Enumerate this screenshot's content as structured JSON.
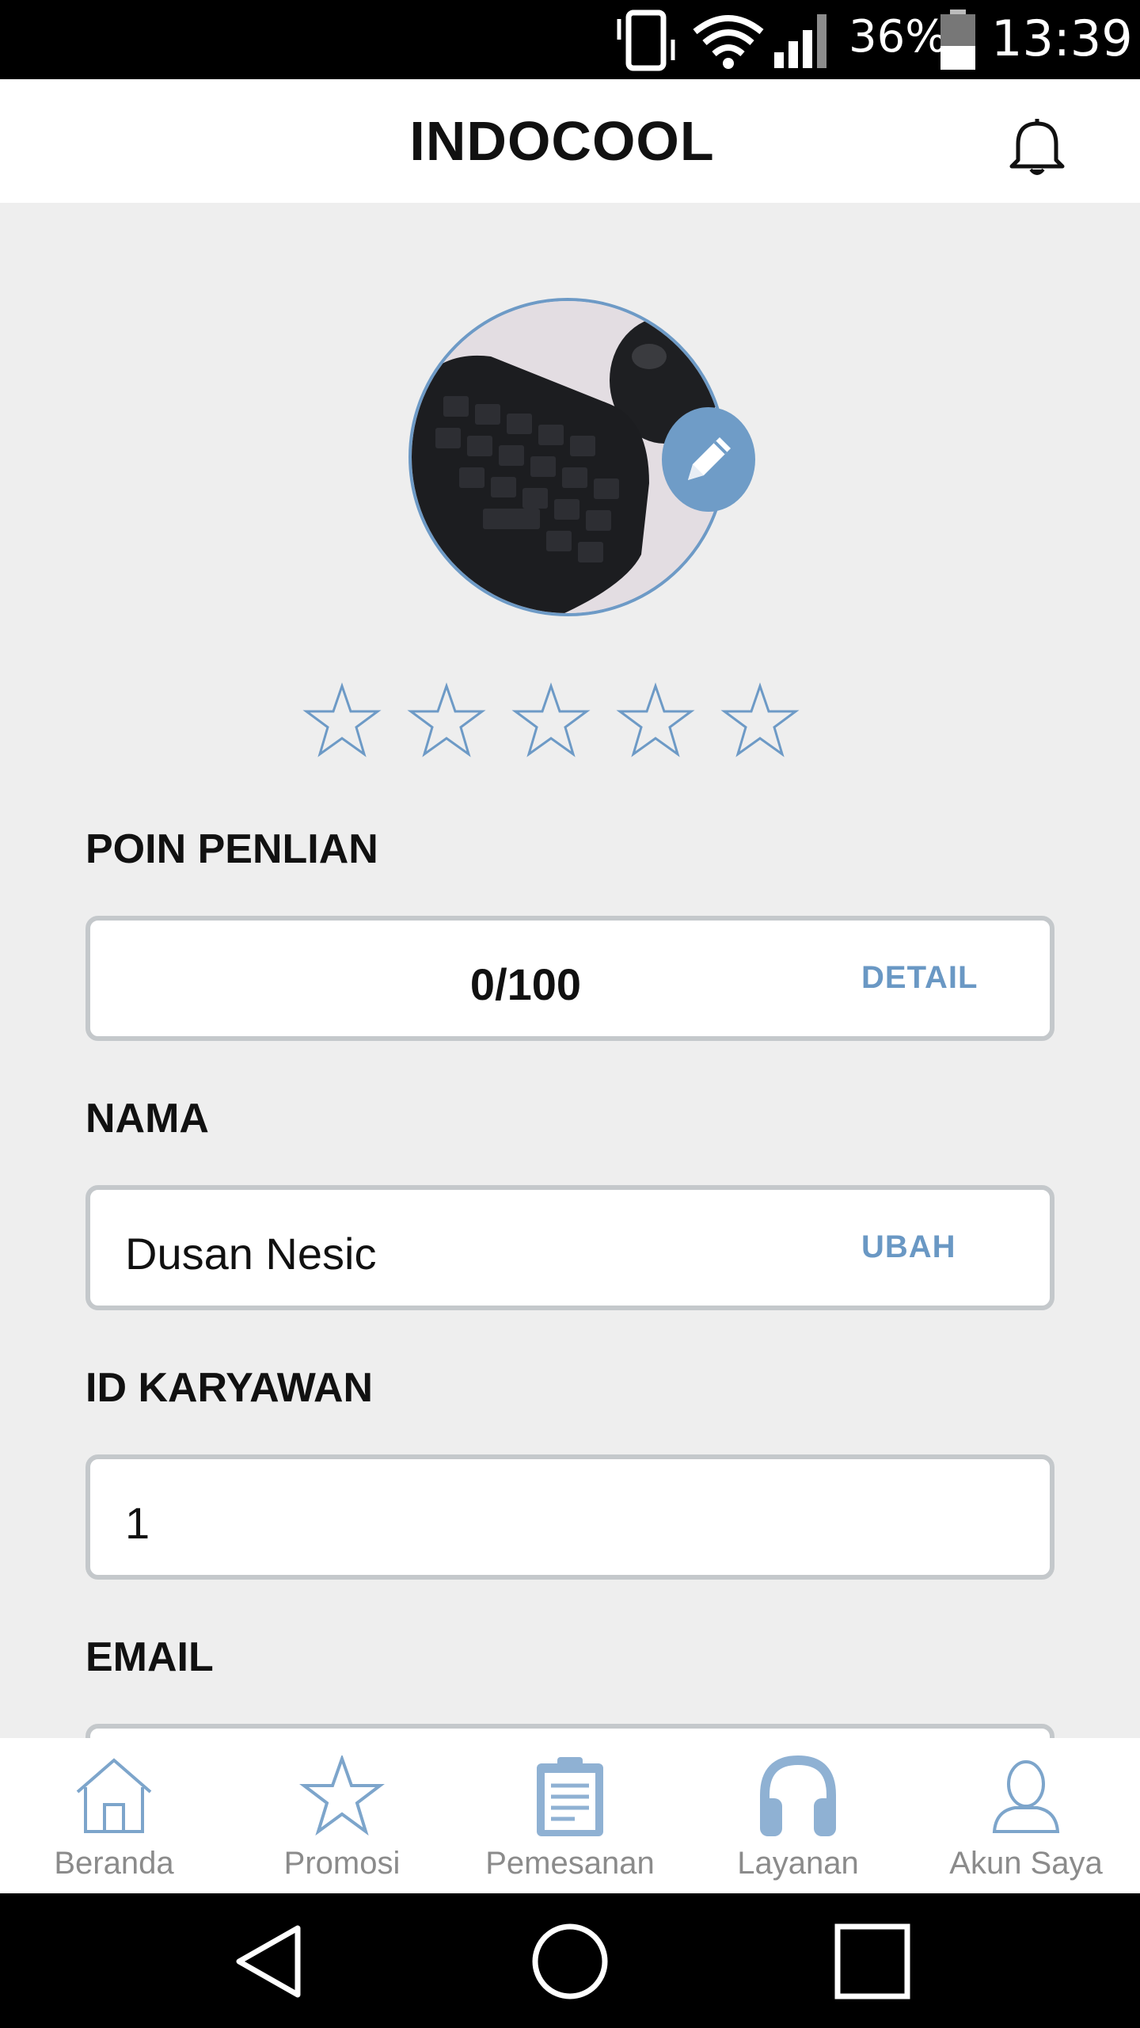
{
  "status_bar": {
    "battery": "36%",
    "time": "13:39"
  },
  "app_bar": {
    "title": "INDOCOOL"
  },
  "profile": {
    "rating_max": 5,
    "rating": 0
  },
  "sections": {
    "points_label": "POIN PENLIAN",
    "points_value": "0/100",
    "points_action": "DETAIL",
    "name_label": "NAMA",
    "name_value": "Dusan Nesic",
    "name_action": "UBAH",
    "employee_id_label": "ID KARYAWAN",
    "employee_id_value": "1",
    "email_label": "EMAIL"
  },
  "bottom_nav": {
    "items": [
      {
        "label": "Beranda",
        "icon": "home-icon"
      },
      {
        "label": "Promosi",
        "icon": "star-icon"
      },
      {
        "label": "Pemesanan",
        "icon": "clipboard-icon"
      },
      {
        "label": "Layanan",
        "icon": "headphones-icon"
      },
      {
        "label": "Akun Saya",
        "icon": "user-icon"
      }
    ]
  },
  "colors": {
    "accent": "#6a98c4",
    "background": "#eeeeee",
    "field_border": "#c4c8cb"
  }
}
